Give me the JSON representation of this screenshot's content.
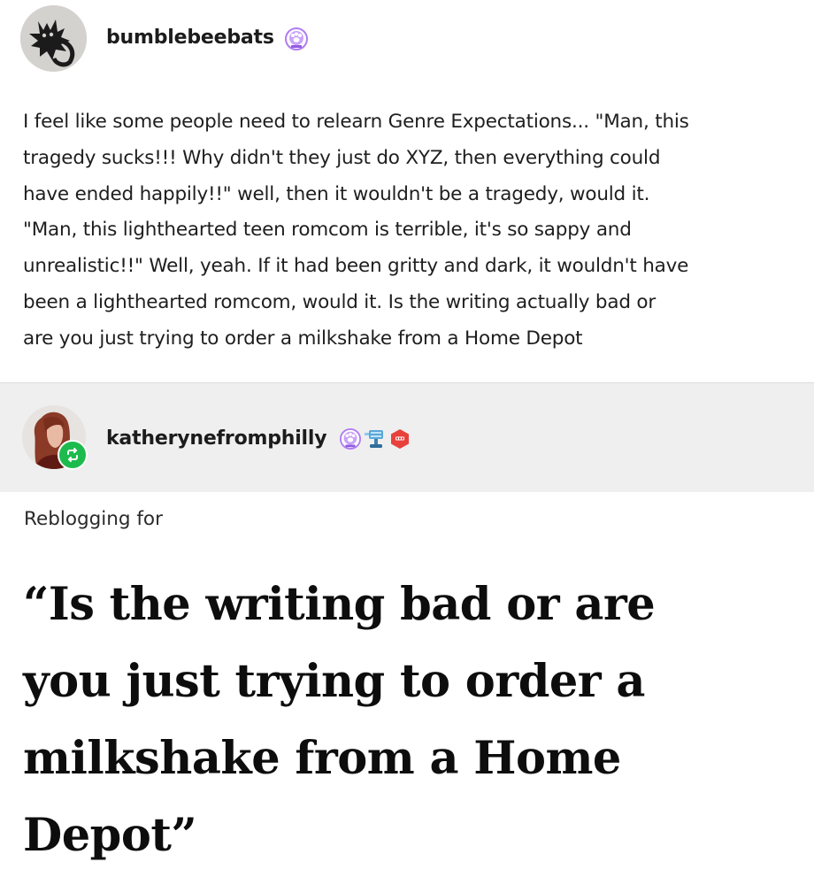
{
  "original_post": {
    "username": "bumblebeebats",
    "badges": [
      "paw-badge-icon"
    ],
    "body_lines": [
      "I feel like some people need to relearn Genre Expectations... \"Man, this",
      "tragedy sucks!!! Why didn't they just do XYZ, then everything could",
      "have ended happily!!\" well, then it wouldn't be a tragedy, would it.",
      "\"Man, this lighthearted teen romcom is terrible, it's so sappy and",
      "unrealistic!!\" Well, yeah. If it had been gritty and dark, it wouldn't have",
      "been a lighthearted romcom, would it. Is the writing actually bad or",
      "are you just trying to order a milkshake from a Home Depot"
    ]
  },
  "reblog": {
    "username": "katherynefromphilly",
    "badges": [
      "paw-badge-icon",
      "fan-badge-icon",
      "hexagon-badge-icon"
    ],
    "intro": "Reblogging for",
    "quote_lines": [
      "“Is the writing bad or are",
      "you just trying to order a",
      "milkshake from a Home",
      "Depot”"
    ]
  },
  "colors": {
    "reblog_band": "#efefef",
    "reblog_icon": "#1dbb4e",
    "paw_badge": "#b07cf0",
    "hexagon_badge": "#e8413c",
    "fan_badge": "#5aa7d8"
  }
}
